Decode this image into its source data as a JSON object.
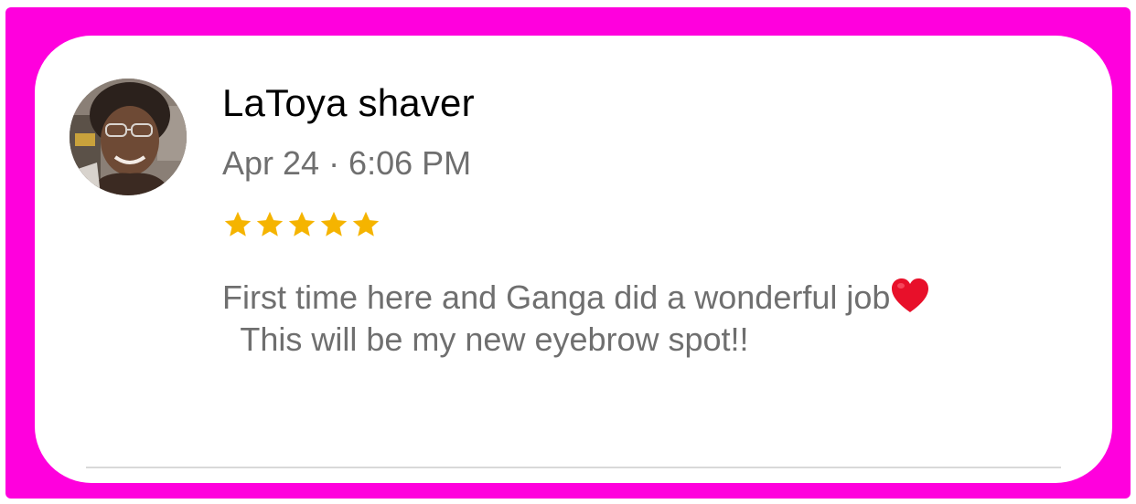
{
  "review": {
    "reviewer_name": "LaToya shaver",
    "timestamp": "Apr 24 · 6:06 PM",
    "rating": 5,
    "rating_max": 5,
    "text_part1": "First time here and Ganga did a wonderful job",
    "text_emoji": "heart-emoji",
    "text_part2": "  This will be my new eyebrow spot!!"
  },
  "icons": {
    "avatar": "reviewer-photo",
    "star": "star-icon",
    "emoji": "red-heart-emoji"
  },
  "colors": {
    "frame": "#ff00dd",
    "card": "#ffffff",
    "name": "#000000",
    "secondary_text": "#6f6f6f",
    "star": "#f5b400",
    "heart": "#e8102a",
    "divider": "#d9d9d9"
  }
}
